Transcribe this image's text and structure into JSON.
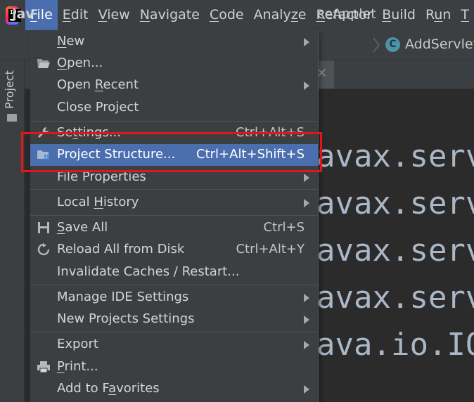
{
  "menubar": {
    "items": [
      {
        "label": "File",
        "mnemonic": "F",
        "rest": "ile"
      },
      {
        "label": "Edit",
        "mnemonic": "E",
        "rest": "dit"
      },
      {
        "label": "View",
        "mnemonic": "V",
        "rest": "iew"
      },
      {
        "label": "Navigate",
        "mnemonic": "N",
        "rest": "avigate"
      },
      {
        "label": "Code",
        "mnemonic": "C",
        "rest": "ode"
      },
      {
        "label": "Analyze",
        "pre": "Analy",
        "mnemonic": "z",
        "rest": "e"
      },
      {
        "label": "Refactor",
        "mnemonic": "R",
        "rest": "efactor"
      },
      {
        "label": "Build",
        "mnemonic": "B",
        "rest": "uild"
      },
      {
        "label": "Run",
        "pre": "R",
        "mnemonic": "u",
        "rest": "n"
      },
      {
        "label": "T",
        "mnemonic": "T",
        "rest": ""
      }
    ]
  },
  "navbar": {
    "left_text": "jav",
    "crumb1": "ceApplet",
    "class_icon": "C",
    "crumb2": "AddServlet"
  },
  "sidebar": {
    "project_label": "Project"
  },
  "editor": {
    "lines": [
      "avax.serv",
      "avax.serv",
      "avax.serv",
      "avax.serv",
      "ava.io.IO"
    ]
  },
  "file_menu": {
    "new": {
      "pre": "",
      "mn": "N",
      "post": "ew"
    },
    "open": {
      "pre": "",
      "mn": "O",
      "post": "pen..."
    },
    "open_recent": {
      "pre": "Open ",
      "mn": "R",
      "post": "ecent"
    },
    "close_project": {
      "text": "Close Project"
    },
    "settings": {
      "pre": "Se",
      "mn": "t",
      "post": "tings...",
      "shortcut": "Ctrl+Alt+S"
    },
    "project_structure": {
      "text": "Project Structure...",
      "shortcut": "Ctrl+Alt+Shift+S"
    },
    "file_properties": {
      "text": "File Properties"
    },
    "local_history": {
      "pre": "Local ",
      "mn": "H",
      "post": "istory"
    },
    "save_all": {
      "pre": "",
      "mn": "S",
      "post": "ave All",
      "shortcut": "Ctrl+S"
    },
    "reload_all": {
      "text": "Reload All from Disk",
      "shortcut": "Ctrl+Alt+Y"
    },
    "invalidate_caches": {
      "text": "Invalidate Caches / Restart..."
    },
    "manage_ide_settings": {
      "text": "Manage IDE Settings"
    },
    "new_projects_settings": {
      "text": "New Projects Settings"
    },
    "export": {
      "text": "Export"
    },
    "print": {
      "pre": "",
      "mn": "P",
      "post": "rint..."
    },
    "add_to_favorites": {
      "pre": "Add to F",
      "mn": "a",
      "post": "vorites"
    }
  },
  "colors": {
    "accent": "#4b6eaf",
    "highlight_box": "#e2141c",
    "menu_bg": "#3c3f41",
    "editor_bg": "#2b2b2b"
  },
  "icons": {
    "open": "folder-open-icon",
    "settings": "wrench-icon",
    "project_structure": "project-structure-icon",
    "save_all": "floppy-disk-icon",
    "reload_all": "reload-icon",
    "print": "printer-icon"
  }
}
